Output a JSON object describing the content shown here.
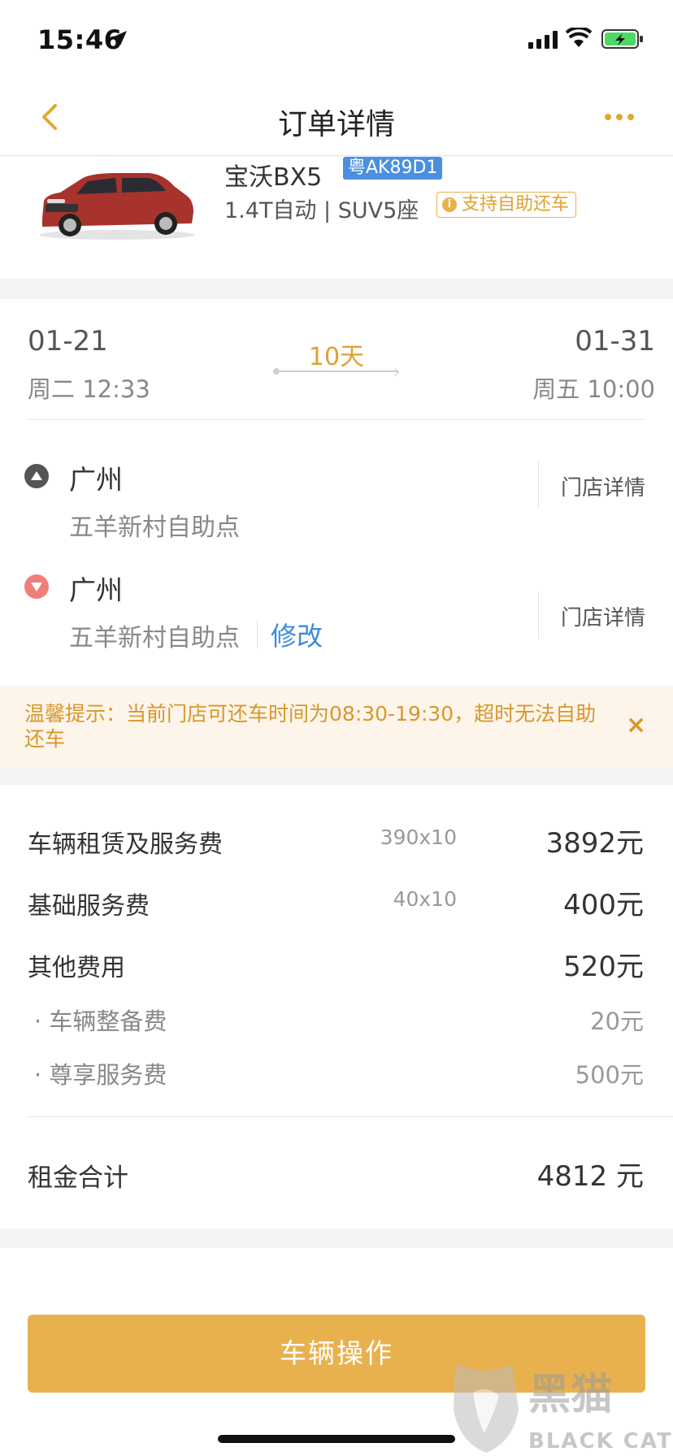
{
  "status_bar": {
    "time": "15:46"
  },
  "nav": {
    "title": "订单详情"
  },
  "car": {
    "name": "宝沃BX5",
    "plate": "粤AK89D1",
    "spec": "1.4T自动 | SUV5座",
    "badge": "支持自助还车"
  },
  "trip": {
    "pickup_date": "01-21",
    "pickup_time": "周二 12:33",
    "return_date": "01-31",
    "return_time": "周五 10:00",
    "duration": "10天",
    "pickup_city": "广州",
    "pickup_store": "五羊新村自助点",
    "return_city": "广州",
    "return_store": "五羊新村自助点",
    "modify_label": "修改",
    "store_detail_label": "门店详情"
  },
  "notice": {
    "text": "温馨提示：当前门店可还车时间为08:30-19:30，超时无法自助还车",
    "close": "×"
  },
  "fees": {
    "rows": [
      {
        "label": "车辆租赁及服务费",
        "mult": "390x10",
        "amount": "3892元"
      },
      {
        "label": "基础服务费",
        "mult": "40x10",
        "amount": "400元"
      },
      {
        "label": "其他费用",
        "mult": "",
        "amount": "520元"
      }
    ],
    "sub_rows": [
      {
        "label": "· 车辆整备费",
        "amount": "20元"
      },
      {
        "label": "· 尊享服务费",
        "amount": "500元"
      }
    ],
    "total_label": "租金合计",
    "total_amount": "4812 元"
  },
  "action": {
    "label": "车辆操作"
  },
  "watermark": {
    "cn": "黑猫",
    "en": "BLACK CAT"
  },
  "colors": {
    "accent": "#e9b14d",
    "link": "#3a8bdc",
    "plate": "#4a8fe0"
  }
}
